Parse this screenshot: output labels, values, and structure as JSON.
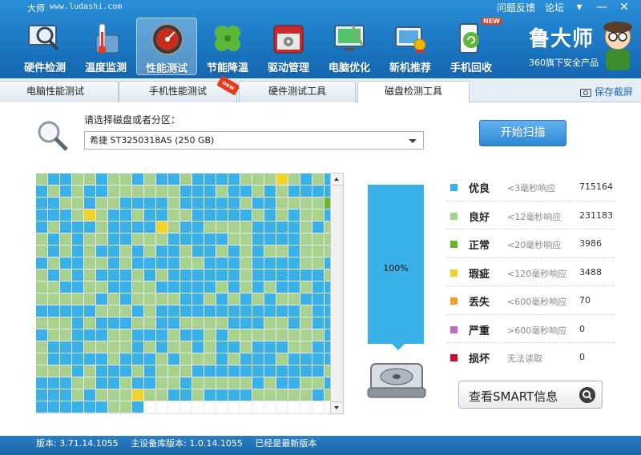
{
  "titlebar": {
    "app_name": "大师",
    "url": "www.ludashi.com",
    "feedback_label": "问题反馈",
    "forum_label": "论坛"
  },
  "nav": {
    "items": [
      {
        "label": "硬件检测",
        "icon": "monitor-magnifier-icon"
      },
      {
        "label": "温度监测",
        "icon": "thermometer-icon"
      },
      {
        "label": "性能测试",
        "icon": "speedometer-icon",
        "active": true
      },
      {
        "label": "节能降温",
        "icon": "clover-icon"
      },
      {
        "label": "驱动管理",
        "icon": "driver-box-icon"
      },
      {
        "label": "电脑优化",
        "icon": "monitor-sweep-icon"
      },
      {
        "label": "新机推荐",
        "icon": "award-monitor-icon"
      },
      {
        "label": "手机回收",
        "icon": "phone-recycle-icon",
        "badge": "NEW"
      }
    ]
  },
  "brand": {
    "name": "鲁大师",
    "subtitle": "360旗下安全产品"
  },
  "tabs": [
    {
      "label": "电脑性能测试"
    },
    {
      "label": "手机性能测试",
      "badge": "new"
    },
    {
      "label": "硬件测试工具"
    },
    {
      "label": "磁盘检测工具",
      "active": true
    }
  ],
  "save_screenshot_label": "保存截屏",
  "disk": {
    "select_label": "请选择磁盘或者分区：",
    "selected_value": "希捷 ST3250318AS  (250 GB)",
    "scan_button_label": "开始扫描"
  },
  "progress": {
    "value": 1.0,
    "label": "100%"
  },
  "legend": [
    {
      "name": "优良",
      "desc": "<3毫秒响应",
      "value": "715164",
      "color": "#3ab0e8"
    },
    {
      "name": "良好",
      "desc": "<12毫秒响应",
      "value": "231183",
      "color": "#a9d18e"
    },
    {
      "name": "正常",
      "desc": "<20毫秒响应",
      "value": "3986",
      "color": "#6ab42f"
    },
    {
      "name": "瑕疵",
      "desc": "<120毫秒响应",
      "value": "3488",
      "color": "#f2d32a"
    },
    {
      "name": "丢失",
      "desc": "<600毫秒响应",
      "value": "70",
      "color": "#f0a030"
    },
    {
      "name": "严重",
      "desc": ">600毫秒响应",
      "value": "0",
      "color": "#c46ac4"
    },
    {
      "name": "损坏",
      "desc": "无法读取",
      "value": "0",
      "color": "#c8102e"
    }
  ],
  "smart_button_label": "查看SMART信息",
  "statusbar": {
    "version": "版本: 3.71.14.1055",
    "db_version": "主设备库版本: 1.0.14.1055",
    "status": "已经是最新版本"
  },
  "colors": {
    "header": "#1e7cc7",
    "excellent": "#3ab0e8",
    "good": "#a9d18e",
    "normal": "#6ab42f",
    "flaw": "#f2d32a"
  }
}
